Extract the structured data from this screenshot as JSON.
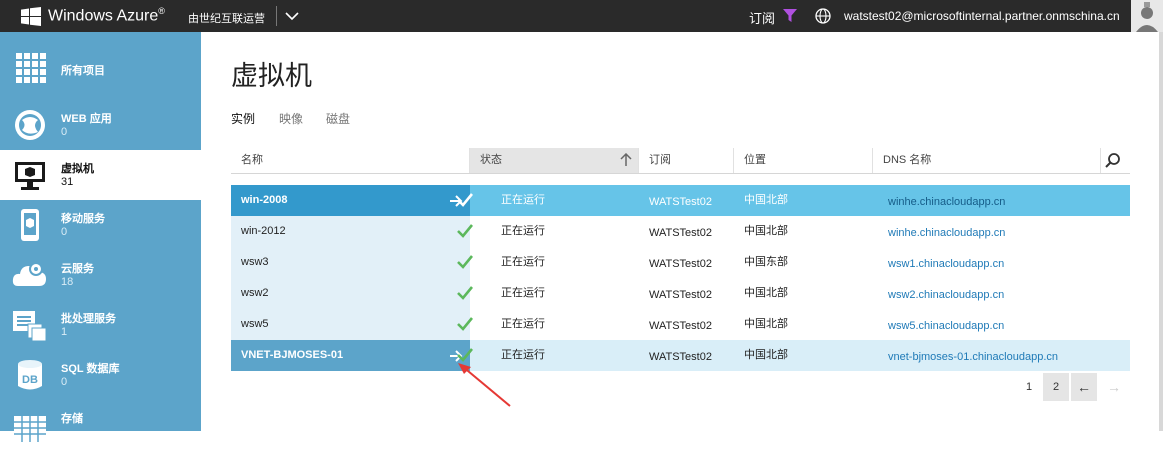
{
  "topbar": {
    "brand": "Windows Azure",
    "brand_mark": "®",
    "operator": "由世纪互联运营",
    "subscription_label": "订阅",
    "account": "watstest02@microsoftinternal.partner.onmschina.cn"
  },
  "sidebar": {
    "items": [
      {
        "label": "所有项目",
        "count": "",
        "icon": "grid-icon"
      },
      {
        "label": "WEB 应用",
        "count": "0",
        "icon": "globe-icon"
      },
      {
        "label": "虚拟机",
        "count": "31",
        "icon": "monitor-icon"
      },
      {
        "label": "移动服务",
        "count": "0",
        "icon": "mobile-icon"
      },
      {
        "label": "云服务",
        "count": "18",
        "icon": "cloud-gear-icon"
      },
      {
        "label": "批处理服务",
        "count": "1",
        "icon": "batch-icon"
      },
      {
        "label": "SQL 数据库",
        "count": "0",
        "icon": "database-icon"
      },
      {
        "label": "存储",
        "count": "",
        "icon": "storage-grid-icon"
      }
    ]
  },
  "main": {
    "title": "虚拟机",
    "tabs": [
      "实例",
      "映像",
      "磁盘"
    ],
    "columns": [
      "名称",
      "状态",
      "订阅",
      "位置",
      "DNS 名称"
    ],
    "rows": [
      {
        "name": "win-2008",
        "status": "正在运行",
        "subscription": "WATSTest02",
        "location": "中国北部",
        "dns": "winhe.chinacloudapp.cn"
      },
      {
        "name": "win-2012",
        "status": "正在运行",
        "subscription": "WATSTest02",
        "location": "中国北部",
        "dns": "winhe.chinacloudapp.cn"
      },
      {
        "name": "wsw3",
        "status": "正在运行",
        "subscription": "WATSTest02",
        "location": "中国东部",
        "dns": "wsw1.chinacloudapp.cn"
      },
      {
        "name": "wsw2",
        "status": "正在运行",
        "subscription": "WATSTest02",
        "location": "中国北部",
        "dns": "wsw2.chinacloudapp.cn"
      },
      {
        "name": "wsw5",
        "status": "正在运行",
        "subscription": "WATSTest02",
        "location": "中国北部",
        "dns": "wsw5.chinacloudapp.cn"
      },
      {
        "name": "VNET-BJMOSES-01",
        "status": "正在运行",
        "subscription": "WATSTest02",
        "location": "中国北部",
        "dns": "vnet-bjmoses-01.chinacloudapp.cn"
      }
    ],
    "pagination": {
      "page1": "1",
      "page2": "2",
      "prev": "←",
      "next": "→"
    }
  },
  "colors": {
    "topbar": "#2a2a2a",
    "sidebar": "#5ca4ca",
    "selected_row": "#66c4e8",
    "selected_name": "#3399cc",
    "check": "#5cb85c",
    "annotation_arrow": "#e53935"
  }
}
